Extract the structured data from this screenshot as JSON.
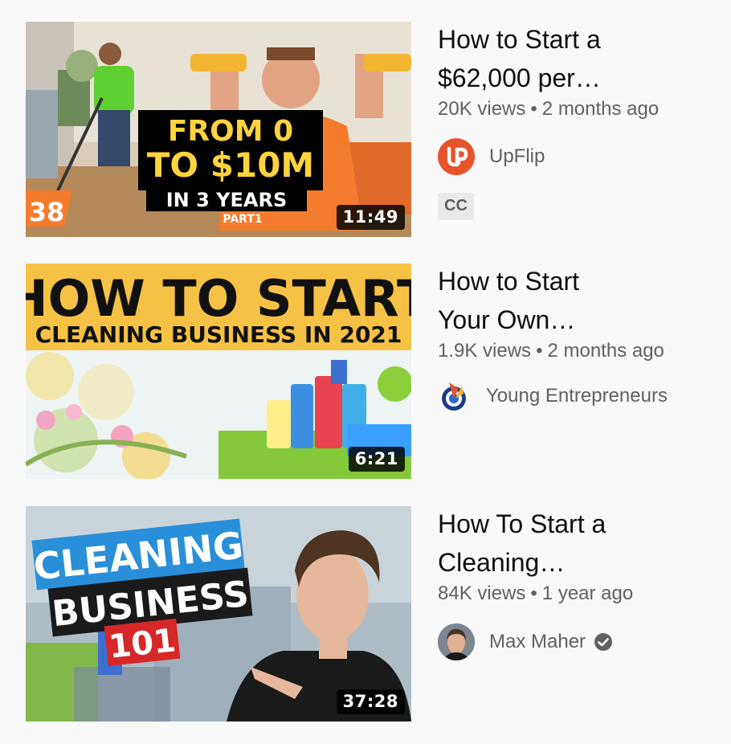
{
  "videos": [
    {
      "title": "How to Start a\n$62,000 per…",
      "views": "20K views",
      "age": "2 months ago",
      "channel": "UpFlip",
      "duration": "11:49",
      "badge": "CC",
      "thumb_text": {
        "line1": "FROM 0",
        "line2": "TO $10M",
        "line3": "IN 3 YEARS",
        "line4": "PART1",
        "number": "38"
      }
    },
    {
      "title": "How to Start\nYour Own…",
      "views": "1.9K views",
      "age": "2 months ago",
      "channel": "Young Entrepreneurs",
      "duration": "6:21",
      "thumb_text": {
        "line1": "HOW TO START",
        "line2": "CLEANING BUSINESS IN 2021"
      }
    },
    {
      "title": "How To Start a\nCleaning…",
      "views": "84K views",
      "age": "1 year ago",
      "channel": "Max Maher",
      "duration": "37:28",
      "verified": true,
      "thumb_text": {
        "line1": "CLEANING",
        "line2": "BUSINESS",
        "line3": "101"
      }
    }
  ],
  "icons": {
    "verified": "verified-check-icon",
    "upflip_logo": "upflip-logo-icon"
  },
  "colors": {
    "upflip": "#e8542b",
    "yellow_banner": "#f6c246",
    "orange_shirt": "#f47c2c",
    "badge_red": "#d62828",
    "badge_blue": "#2a8fd9"
  }
}
